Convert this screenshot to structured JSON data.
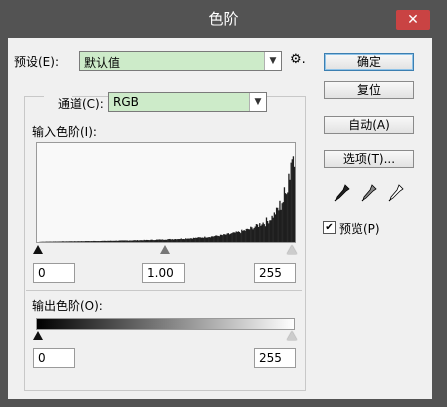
{
  "window": {
    "title": "色阶",
    "close_glyph": "✕"
  },
  "preset": {
    "label": "预设(E):",
    "value": "默认值",
    "gear_glyph": "⚙."
  },
  "channel": {
    "label": "通道(C):",
    "value": "RGB"
  },
  "input_levels": {
    "label": "输入色阶(I):",
    "black": "0",
    "gamma": "1.00",
    "white": "255"
  },
  "output_levels": {
    "label": "输出色阶(O):",
    "black": "0",
    "white": "255"
  },
  "buttons": {
    "ok": "确定",
    "reset": "复位",
    "auto": "自动(A)",
    "options": "选项(T)..."
  },
  "preview": {
    "label": "预览(P)",
    "checked": true
  },
  "histogram": {
    "bins": [
      0.0,
      0.002,
      0.003,
      0.003,
      0.004,
      0.004,
      0.004,
      0.005,
      0.005,
      0.005,
      0.006,
      0.006,
      0.006,
      0.006,
      0.007,
      0.007,
      0.007,
      0.007,
      0.008,
      0.008,
      0.008,
      0.009,
      0.009,
      0.009,
      0.009,
      0.01,
      0.01,
      0.01,
      0.011,
      0.011,
      0.011,
      0.012,
      0.012,
      0.012,
      0.013,
      0.013,
      0.014,
      0.014,
      0.014,
      0.015,
      0.015,
      0.016,
      0.016,
      0.017,
      0.017,
      0.018,
      0.018,
      0.019,
      0.019,
      0.02,
      0.021,
      0.021,
      0.022,
      0.023,
      0.024,
      0.024,
      0.025,
      0.026,
      0.027,
      0.028,
      0.029,
      0.03,
      0.031,
      0.032,
      0.033,
      0.034,
      0.036,
      0.037,
      0.038,
      0.04,
      0.041,
      0.043,
      0.045,
      0.047,
      0.049,
      0.051,
      0.053,
      0.055,
      0.058,
      0.06,
      0.063,
      0.066,
      0.069,
      0.072,
      0.076,
      0.08,
      0.084,
      0.088,
      0.093,
      0.098,
      0.103,
      0.109,
      0.116,
      0.123,
      0.13,
      0.139,
      0.148,
      0.158,
      0.169,
      0.181,
      0.195,
      0.21,
      0.228,
      0.247,
      0.27,
      0.296,
      0.325,
      0.36,
      0.4,
      0.45,
      0.52,
      0.62,
      0.75,
      0.9,
      1.0
    ]
  },
  "colors": {
    "field_green": "#cdebc9",
    "title_bg": "#535353",
    "close_red": "#c94343"
  }
}
